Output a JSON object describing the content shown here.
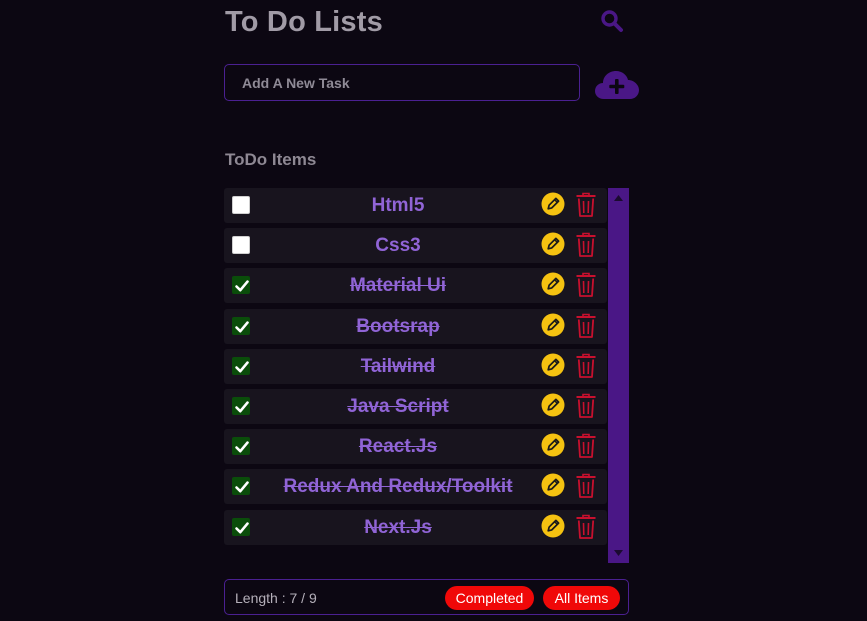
{
  "header": {
    "title": "To Do Lists"
  },
  "input": {
    "placeholder": "Add A New Task",
    "value": ""
  },
  "list": {
    "heading": "ToDo Items",
    "items": [
      {
        "label": "Html5",
        "completed": false
      },
      {
        "label": "Css3",
        "completed": false
      },
      {
        "label": "Material Ui",
        "completed": true
      },
      {
        "label": "Bootsrap",
        "completed": true
      },
      {
        "label": "Tailwind",
        "completed": true
      },
      {
        "label": "Java Script",
        "completed": true
      },
      {
        "label": "React.Js",
        "completed": true
      },
      {
        "label": "Redux And Redux/Toolkit",
        "completed": true
      },
      {
        "label": "Next.Js",
        "completed": true
      }
    ]
  },
  "footer": {
    "length_text": "Length : 7 / 9",
    "completed_label": "Completed",
    "all_items_label": "All Items"
  },
  "icons": {
    "search": "search-icon",
    "add": "cloud-plus-icon",
    "edit": "pencil-icon",
    "delete": "trash-icon"
  },
  "colors": {
    "background": "#0c0712",
    "accent": "#4a1786",
    "item_text": "#9064d6",
    "edit": "#f5c211",
    "delete": "#c8102e",
    "pill": "#f00808",
    "checked": "#0a4d0a"
  }
}
